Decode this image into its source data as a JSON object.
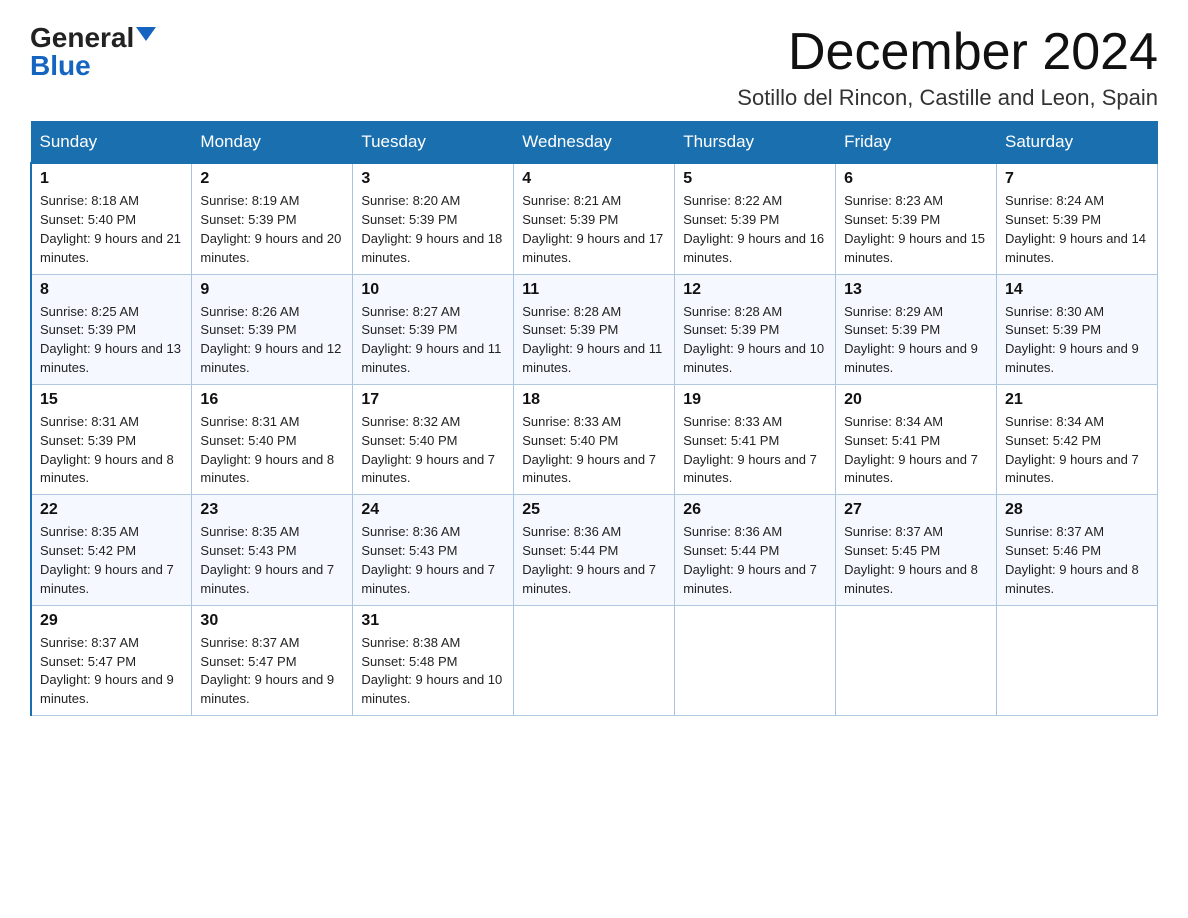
{
  "logo": {
    "general": "General",
    "blue": "Blue",
    "triangle": "▲"
  },
  "title": "December 2024",
  "subtitle": "Sotillo del Rincon, Castille and Leon, Spain",
  "headers": [
    "Sunday",
    "Monday",
    "Tuesday",
    "Wednesday",
    "Thursday",
    "Friday",
    "Saturday"
  ],
  "weeks": [
    [
      {
        "day": "1",
        "sunrise": "8:18 AM",
        "sunset": "5:40 PM",
        "daylight": "9 hours and 21 minutes."
      },
      {
        "day": "2",
        "sunrise": "8:19 AM",
        "sunset": "5:39 PM",
        "daylight": "9 hours and 20 minutes."
      },
      {
        "day": "3",
        "sunrise": "8:20 AM",
        "sunset": "5:39 PM",
        "daylight": "9 hours and 18 minutes."
      },
      {
        "day": "4",
        "sunrise": "8:21 AM",
        "sunset": "5:39 PM",
        "daylight": "9 hours and 17 minutes."
      },
      {
        "day": "5",
        "sunrise": "8:22 AM",
        "sunset": "5:39 PM",
        "daylight": "9 hours and 16 minutes."
      },
      {
        "day": "6",
        "sunrise": "8:23 AM",
        "sunset": "5:39 PM",
        "daylight": "9 hours and 15 minutes."
      },
      {
        "day": "7",
        "sunrise": "8:24 AM",
        "sunset": "5:39 PM",
        "daylight": "9 hours and 14 minutes."
      }
    ],
    [
      {
        "day": "8",
        "sunrise": "8:25 AM",
        "sunset": "5:39 PM",
        "daylight": "9 hours and 13 minutes."
      },
      {
        "day": "9",
        "sunrise": "8:26 AM",
        "sunset": "5:39 PM",
        "daylight": "9 hours and 12 minutes."
      },
      {
        "day": "10",
        "sunrise": "8:27 AM",
        "sunset": "5:39 PM",
        "daylight": "9 hours and 11 minutes."
      },
      {
        "day": "11",
        "sunrise": "8:28 AM",
        "sunset": "5:39 PM",
        "daylight": "9 hours and 11 minutes."
      },
      {
        "day": "12",
        "sunrise": "8:28 AM",
        "sunset": "5:39 PM",
        "daylight": "9 hours and 10 minutes."
      },
      {
        "day": "13",
        "sunrise": "8:29 AM",
        "sunset": "5:39 PM",
        "daylight": "9 hours and 9 minutes."
      },
      {
        "day": "14",
        "sunrise": "8:30 AM",
        "sunset": "5:39 PM",
        "daylight": "9 hours and 9 minutes."
      }
    ],
    [
      {
        "day": "15",
        "sunrise": "8:31 AM",
        "sunset": "5:39 PM",
        "daylight": "9 hours and 8 minutes."
      },
      {
        "day": "16",
        "sunrise": "8:31 AM",
        "sunset": "5:40 PM",
        "daylight": "9 hours and 8 minutes."
      },
      {
        "day": "17",
        "sunrise": "8:32 AM",
        "sunset": "5:40 PM",
        "daylight": "9 hours and 7 minutes."
      },
      {
        "day": "18",
        "sunrise": "8:33 AM",
        "sunset": "5:40 PM",
        "daylight": "9 hours and 7 minutes."
      },
      {
        "day": "19",
        "sunrise": "8:33 AM",
        "sunset": "5:41 PM",
        "daylight": "9 hours and 7 minutes."
      },
      {
        "day": "20",
        "sunrise": "8:34 AM",
        "sunset": "5:41 PM",
        "daylight": "9 hours and 7 minutes."
      },
      {
        "day": "21",
        "sunrise": "8:34 AM",
        "sunset": "5:42 PM",
        "daylight": "9 hours and 7 minutes."
      }
    ],
    [
      {
        "day": "22",
        "sunrise": "8:35 AM",
        "sunset": "5:42 PM",
        "daylight": "9 hours and 7 minutes."
      },
      {
        "day": "23",
        "sunrise": "8:35 AM",
        "sunset": "5:43 PM",
        "daylight": "9 hours and 7 minutes."
      },
      {
        "day": "24",
        "sunrise": "8:36 AM",
        "sunset": "5:43 PM",
        "daylight": "9 hours and 7 minutes."
      },
      {
        "day": "25",
        "sunrise": "8:36 AM",
        "sunset": "5:44 PM",
        "daylight": "9 hours and 7 minutes."
      },
      {
        "day": "26",
        "sunrise": "8:36 AM",
        "sunset": "5:44 PM",
        "daylight": "9 hours and 7 minutes."
      },
      {
        "day": "27",
        "sunrise": "8:37 AM",
        "sunset": "5:45 PM",
        "daylight": "9 hours and 8 minutes."
      },
      {
        "day": "28",
        "sunrise": "8:37 AM",
        "sunset": "5:46 PM",
        "daylight": "9 hours and 8 minutes."
      }
    ],
    [
      {
        "day": "29",
        "sunrise": "8:37 AM",
        "sunset": "5:47 PM",
        "daylight": "9 hours and 9 minutes."
      },
      {
        "day": "30",
        "sunrise": "8:37 AM",
        "sunset": "5:47 PM",
        "daylight": "9 hours and 9 minutes."
      },
      {
        "day": "31",
        "sunrise": "8:38 AM",
        "sunset": "5:48 PM",
        "daylight": "9 hours and 10 minutes."
      },
      null,
      null,
      null,
      null
    ]
  ]
}
